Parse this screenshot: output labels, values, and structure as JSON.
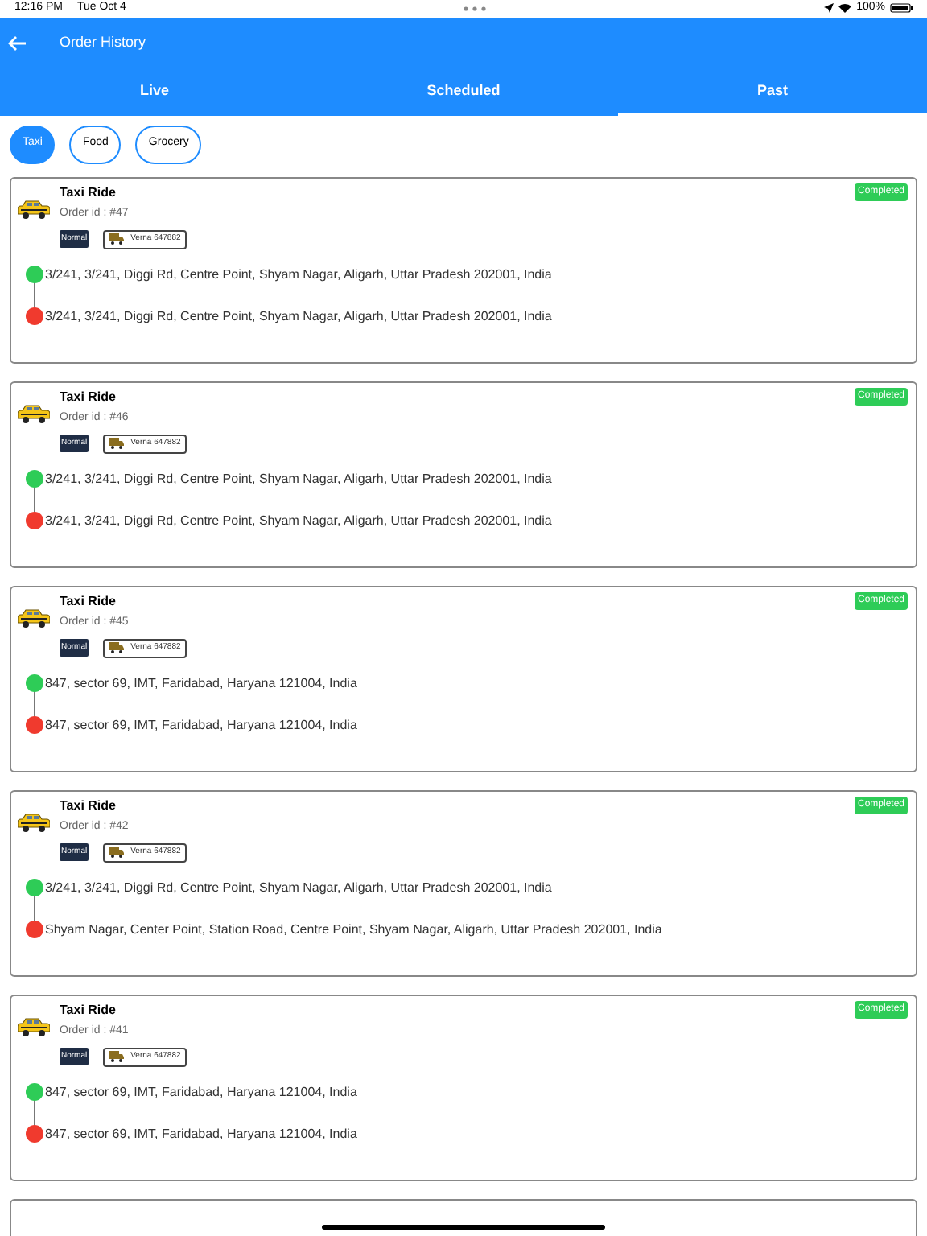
{
  "status_bar": {
    "time": "12:16 PM",
    "date": "Tue Oct 4",
    "battery": "100%"
  },
  "header": {
    "title": "Order History"
  },
  "tabs": [
    {
      "label": "Live",
      "selected": false
    },
    {
      "label": "Scheduled",
      "selected": false
    },
    {
      "label": "Past",
      "selected": true
    }
  ],
  "filters": [
    {
      "label": "Taxi",
      "selected": true
    },
    {
      "label": "Food",
      "selected": false
    },
    {
      "label": "Grocery",
      "selected": false
    }
  ],
  "orders": [
    {
      "title": "Taxi Ride",
      "order_id": "Order id : #47",
      "type": "Normal",
      "vehicle": "Verna 647882",
      "status": "Completed",
      "pickup": "3/241, 3/241, Diggi Rd, Centre Point, Shyam Nagar, Aligarh, Uttar Pradesh 202001, India",
      "drop": "3/241, 3/241, Diggi Rd, Centre Point, Shyam Nagar, Aligarh, Uttar Pradesh 202001, India"
    },
    {
      "title": "Taxi Ride",
      "order_id": "Order id : #46",
      "type": "Normal",
      "vehicle": "Verna 647882",
      "status": "Completed",
      "pickup": "3/241, 3/241, Diggi Rd, Centre Point, Shyam Nagar, Aligarh, Uttar Pradesh 202001, India",
      "drop": "3/241, 3/241, Diggi Rd, Centre Point, Shyam Nagar, Aligarh, Uttar Pradesh 202001, India"
    },
    {
      "title": "Taxi Ride",
      "order_id": "Order id : #45",
      "type": "Normal",
      "vehicle": "Verna 647882",
      "status": "Completed",
      "pickup": "847, sector 69, IMT, Faridabad, Haryana 121004, India",
      "drop": "847, sector 69, IMT, Faridabad, Haryana 121004, India"
    },
    {
      "title": "Taxi Ride",
      "order_id": "Order id : #42",
      "type": "Normal",
      "vehicle": "Verna 647882",
      "status": "Completed",
      "pickup": "3/241, 3/241, Diggi Rd, Centre Point, Shyam Nagar, Aligarh, Uttar Pradesh 202001, India",
      "drop": "Shyam Nagar, Center Point, Station Road, Centre Point, Shyam Nagar, Aligarh, Uttar Pradesh 202001, India"
    },
    {
      "title": "Taxi Ride",
      "order_id": "Order id : #41",
      "type": "Normal",
      "vehicle": "Verna 647882",
      "status": "Completed",
      "pickup": "847, sector 69, IMT, Faridabad, Haryana 121004, India",
      "drop": "847, sector 69, IMT, Faridabad, Haryana 121004, India"
    }
  ]
}
